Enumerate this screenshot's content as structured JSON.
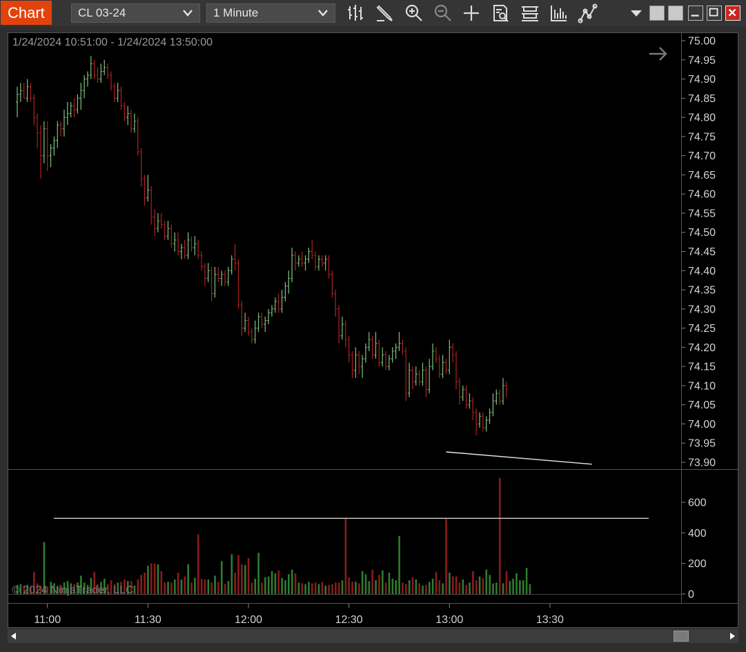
{
  "app": {
    "tab_label": "Chart",
    "instrument": "CL 03-24",
    "interval": "1 Minute",
    "range_label": "1/24/2024 10:51:00 - 1/24/2024 13:50:00",
    "watermark": "© 2024 NinjaTrader, LLC"
  },
  "toolbar": {
    "icons": [
      "bar-type-icon",
      "pencil-draw-icon",
      "zoom-in-icon",
      "zoom-out-icon",
      "crosshair-icon",
      "data-box-icon",
      "properties-icon",
      "indicators-icon",
      "strategies-icon"
    ]
  },
  "window_controls": [
    "dropdown-icon",
    "tile-a-icon",
    "tile-b-icon",
    "minimize-icon",
    "maximize-icon",
    "close-icon"
  ],
  "colors": {
    "up": "#7fc57f",
    "down": "#b02222",
    "vol_up": "#2f7d2f",
    "vol_down": "#8b1c1c",
    "accent": "#e2430c",
    "close_button": "#c8261e"
  },
  "chart_data": [
    {
      "type": "ohlc",
      "panel": "price",
      "y_ticks": [
        "75.00",
        "74.95",
        "74.90",
        "74.85",
        "74.80",
        "74.75",
        "74.70",
        "74.65",
        "74.60",
        "74.55",
        "74.50",
        "74.45",
        "74.40",
        "74.35",
        "74.30",
        "74.25",
        "74.20",
        "74.15",
        "74.10",
        "74.05",
        "74.00",
        "73.95",
        "73.90"
      ],
      "ylim": [
        73.88,
        75.02
      ],
      "x_ticks": [
        "11:00",
        "11:30",
        "12:00",
        "12:30",
        "13:00",
        "13:30"
      ],
      "x_minutes": [
        0,
        30,
        60,
        90,
        120,
        150
      ],
      "xlim_minutes": [
        -9,
        180
      ],
      "first_bar_minute": -9,
      "bars": [
        [
          74.84,
          74.88,
          74.8,
          74.86
        ],
        [
          74.86,
          74.89,
          74.84,
          74.87
        ],
        [
          74.87,
          74.89,
          74.85,
          74.85
        ],
        [
          74.85,
          74.9,
          74.84,
          74.88
        ],
        [
          74.88,
          74.89,
          74.84,
          74.85
        ],
        [
          74.85,
          74.86,
          74.78,
          74.8
        ],
        [
          74.8,
          74.81,
          74.72,
          74.76
        ],
        [
          74.76,
          74.78,
          74.64,
          74.7
        ],
        [
          74.7,
          74.79,
          74.68,
          74.77
        ],
        [
          74.77,
          74.79,
          74.66,
          74.7
        ],
        [
          74.7,
          74.73,
          74.67,
          74.72
        ],
        [
          74.72,
          74.75,
          74.7,
          74.74
        ],
        [
          74.74,
          74.79,
          74.72,
          74.78
        ],
        [
          74.78,
          74.79,
          74.75,
          74.77
        ],
        [
          74.77,
          74.82,
          74.75,
          74.8
        ],
        [
          74.8,
          74.84,
          74.78,
          74.81
        ],
        [
          74.81,
          74.84,
          74.8,
          74.83
        ],
        [
          74.83,
          74.85,
          74.8,
          74.82
        ],
        [
          74.82,
          74.86,
          74.81,
          74.85
        ],
        [
          74.85,
          74.89,
          74.82,
          74.87
        ],
        [
          74.87,
          74.91,
          74.85,
          74.9
        ],
        [
          74.9,
          74.92,
          74.88,
          74.91
        ],
        [
          74.91,
          74.96,
          74.9,
          74.94
        ],
        [
          74.94,
          74.95,
          74.9,
          74.91
        ],
        [
          74.91,
          74.93,
          74.89,
          74.9
        ],
        [
          74.9,
          74.94,
          74.89,
          74.92
        ],
        [
          74.92,
          74.95,
          74.91,
          74.93
        ],
        [
          74.93,
          74.94,
          74.9,
          74.91
        ],
        [
          74.91,
          74.92,
          74.87,
          74.88
        ],
        [
          74.88,
          74.89,
          74.84,
          74.85
        ],
        [
          74.85,
          74.89,
          74.84,
          74.87
        ],
        [
          74.87,
          74.88,
          74.82,
          74.83
        ],
        [
          74.83,
          74.84,
          74.79,
          74.8
        ],
        [
          74.8,
          74.83,
          74.78,
          74.81
        ],
        [
          74.81,
          74.82,
          74.76,
          74.77
        ],
        [
          74.77,
          74.81,
          74.76,
          74.79
        ],
        [
          74.79,
          74.8,
          74.7,
          74.71
        ],
        [
          74.71,
          74.72,
          74.62,
          74.64
        ],
        [
          74.64,
          74.65,
          74.57,
          74.59
        ],
        [
          74.59,
          74.65,
          74.58,
          74.61
        ],
        [
          74.61,
          74.62,
          74.52,
          74.54
        ],
        [
          74.54,
          74.56,
          74.49,
          74.51
        ],
        [
          74.51,
          74.55,
          74.5,
          74.53
        ],
        [
          74.53,
          74.55,
          74.51,
          74.52
        ],
        [
          74.52,
          74.53,
          74.48,
          74.49
        ],
        [
          74.49,
          74.53,
          74.48,
          74.51
        ],
        [
          74.51,
          74.52,
          74.46,
          74.47
        ],
        [
          74.47,
          74.5,
          74.45,
          74.48
        ],
        [
          74.48,
          74.5,
          74.44,
          74.45
        ],
        [
          74.45,
          74.47,
          74.43,
          74.46
        ],
        [
          74.46,
          74.48,
          74.43,
          74.44
        ],
        [
          74.44,
          74.5,
          74.43,
          74.48
        ],
        [
          74.48,
          74.49,
          74.45,
          74.46
        ],
        [
          74.46,
          74.49,
          74.44,
          74.47
        ],
        [
          74.47,
          74.48,
          74.43,
          74.44
        ],
        [
          74.44,
          74.45,
          74.4,
          74.41
        ],
        [
          74.41,
          74.42,
          74.36,
          74.38
        ],
        [
          74.38,
          74.42,
          74.37,
          74.4
        ],
        [
          74.4,
          74.41,
          74.32,
          74.34
        ],
        [
          74.34,
          74.41,
          74.33,
          74.39
        ],
        [
          74.39,
          74.41,
          74.37,
          74.38
        ],
        [
          74.38,
          74.4,
          74.36,
          74.39
        ],
        [
          74.39,
          74.4,
          74.36,
          74.37
        ],
        [
          74.37,
          74.41,
          74.36,
          74.4
        ],
        [
          74.4,
          74.44,
          74.39,
          74.43
        ],
        [
          74.43,
          74.47,
          74.4,
          74.42
        ],
        [
          74.42,
          74.43,
          74.3,
          74.31
        ],
        [
          74.31,
          74.32,
          74.23,
          74.25
        ],
        [
          74.25,
          74.29,
          74.24,
          74.27
        ],
        [
          74.27,
          74.28,
          74.23,
          74.24
        ],
        [
          74.24,
          74.25,
          74.21,
          74.22
        ],
        [
          74.22,
          74.27,
          74.21,
          74.25
        ],
        [
          74.25,
          74.29,
          74.24,
          74.28
        ],
        [
          74.28,
          74.29,
          74.25,
          74.26
        ],
        [
          74.26,
          74.28,
          74.24,
          74.27
        ],
        [
          74.27,
          74.3,
          74.26,
          74.29
        ],
        [
          74.29,
          74.31,
          74.28,
          74.3
        ],
        [
          74.3,
          74.33,
          74.29,
          74.32
        ],
        [
          74.32,
          74.34,
          74.29,
          74.3
        ],
        [
          74.3,
          74.35,
          74.29,
          74.33
        ],
        [
          74.33,
          74.37,
          74.32,
          74.36
        ],
        [
          74.36,
          74.4,
          74.34,
          74.38
        ],
        [
          74.38,
          74.46,
          74.37,
          74.44
        ],
        [
          74.44,
          74.45,
          74.4,
          74.42
        ],
        [
          74.42,
          74.44,
          74.41,
          74.43
        ],
        [
          74.43,
          74.45,
          74.41,
          74.42
        ],
        [
          74.42,
          74.44,
          74.4,
          74.43
        ],
        [
          74.43,
          74.46,
          74.42,
          74.45
        ],
        [
          74.45,
          74.48,
          74.43,
          74.44
        ],
        [
          74.44,
          74.45,
          74.4,
          74.41
        ],
        [
          74.41,
          74.44,
          74.4,
          74.43
        ],
        [
          74.43,
          74.44,
          74.41,
          74.42
        ],
        [
          74.42,
          74.44,
          74.4,
          74.43
        ],
        [
          74.43,
          74.44,
          74.38,
          74.39
        ],
        [
          74.39,
          74.4,
          74.33,
          74.34
        ],
        [
          74.34,
          74.35,
          74.28,
          74.3
        ],
        [
          74.3,
          74.31,
          74.21,
          74.23
        ],
        [
          74.23,
          74.28,
          74.22,
          74.26
        ],
        [
          74.26,
          74.27,
          74.2,
          74.22
        ],
        [
          74.22,
          74.23,
          74.16,
          74.18
        ],
        [
          74.18,
          74.19,
          74.12,
          74.14
        ],
        [
          74.14,
          74.2,
          74.12,
          74.18
        ],
        [
          74.18,
          74.19,
          74.13,
          74.15
        ],
        [
          74.15,
          74.18,
          74.12,
          74.17
        ],
        [
          74.17,
          74.21,
          74.16,
          74.2
        ],
        [
          74.2,
          74.24,
          74.19,
          74.22
        ],
        [
          74.22,
          74.23,
          74.17,
          74.18
        ],
        [
          74.18,
          74.24,
          74.17,
          74.21
        ],
        [
          74.21,
          74.22,
          74.15,
          74.16
        ],
        [
          74.16,
          74.2,
          74.15,
          74.18
        ],
        [
          74.18,
          74.19,
          74.14,
          74.15
        ],
        [
          74.15,
          74.18,
          74.14,
          74.17
        ],
        [
          74.17,
          74.2,
          74.16,
          74.19
        ],
        [
          74.19,
          74.21,
          74.17,
          74.2
        ],
        [
          74.2,
          74.24,
          74.19,
          74.21
        ],
        [
          74.21,
          74.22,
          74.18,
          74.19
        ],
        [
          74.19,
          74.2,
          74.06,
          74.08
        ],
        [
          74.08,
          74.16,
          74.07,
          74.14
        ],
        [
          74.14,
          74.15,
          74.09,
          74.11
        ],
        [
          74.11,
          74.15,
          74.1,
          74.13
        ],
        [
          74.13,
          74.14,
          74.1,
          74.11
        ],
        [
          74.11,
          74.16,
          74.1,
          74.14
        ],
        [
          74.14,
          74.15,
          74.07,
          74.09
        ],
        [
          74.09,
          74.17,
          74.08,
          74.15
        ],
        [
          74.15,
          74.21,
          74.14,
          74.19
        ],
        [
          74.19,
          74.2,
          74.16,
          74.17
        ],
        [
          74.17,
          74.18,
          74.12,
          74.13
        ],
        [
          74.13,
          74.18,
          74.12,
          74.16
        ],
        [
          74.16,
          74.17,
          74.13,
          74.14
        ],
        [
          74.14,
          74.22,
          74.13,
          74.2
        ],
        [
          74.2,
          74.21,
          74.16,
          74.18
        ],
        [
          74.18,
          74.19,
          74.09,
          74.11
        ],
        [
          74.11,
          74.12,
          74.05,
          74.07
        ],
        [
          74.07,
          74.1,
          74.06,
          74.09
        ],
        [
          74.09,
          74.1,
          74.04,
          74.05
        ],
        [
          74.05,
          74.08,
          74.04,
          74.06
        ],
        [
          74.06,
          74.07,
          74.01,
          74.03
        ],
        [
          74.03,
          74.04,
          73.97,
          74.0
        ],
        [
          74.0,
          74.03,
          73.99,
          74.02
        ],
        [
          74.02,
          74.03,
          73.98,
          73.99
        ],
        [
          73.99,
          74.02,
          73.98,
          74.01
        ],
        [
          74.01,
          74.04,
          74.0,
          74.03
        ],
        [
          74.03,
          74.08,
          74.02,
          74.06
        ],
        [
          74.06,
          74.09,
          74.05,
          74.08
        ],
        [
          74.08,
          74.09,
          74.05,
          74.06
        ],
        [
          74.06,
          74.12,
          74.05,
          74.1
        ],
        [
          74.1,
          74.11,
          74.07,
          74.09
        ]
      ],
      "annotations": [
        {
          "type": "trendline",
          "x": [
            119.0,
            162.5
          ],
          "y": [
            73.927,
            73.895
          ]
        }
      ]
    },
    {
      "type": "bar",
      "panel": "volume",
      "y_ticks": [
        "0",
        "200",
        "400",
        "600"
      ],
      "ylim": [
        -20,
        760
      ],
      "values": [
        60,
        65,
        55,
        60,
        45,
        145,
        70,
        55,
        340,
        50,
        80,
        70,
        50,
        60,
        75,
        85,
        70,
        65,
        75,
        120,
        75,
        60,
        105,
        145,
        65,
        80,
        100,
        65,
        90,
        65,
        75,
        80,
        95,
        85,
        85,
        55,
        95,
        125,
        140,
        185,
        200,
        200,
        195,
        150,
        75,
        80,
        75,
        95,
        140,
        95,
        115,
        195,
        75,
        105,
        390,
        100,
        95,
        95,
        75,
        120,
        80,
        215,
        65,
        85,
        260,
        140,
        255,
        195,
        190,
        235,
        75,
        100,
        270,
        75,
        110,
        115,
        150,
        135,
        155,
        105,
        90,
        130,
        160,
        135,
        75,
        70,
        65,
        80,
        70,
        75,
        65,
        80,
        55,
        60,
        65,
        75,
        75,
        90,
        495,
        110,
        80,
        80,
        70,
        150,
        130,
        85,
        160,
        90,
        125,
        155,
        75,
        140,
        100,
        90,
        380,
        75,
        65,
        90,
        110,
        95,
        70,
        55,
        60,
        80,
        100,
        145,
        90,
        70,
        490,
        140,
        115,
        115,
        75,
        95,
        60,
        75,
        150,
        90,
        115,
        105,
        160,
        125,
        70,
        75,
        760,
        70,
        150,
        85,
        100,
        135,
        90,
        90,
        170,
        65
      ],
      "reference_line": 495
    }
  ]
}
